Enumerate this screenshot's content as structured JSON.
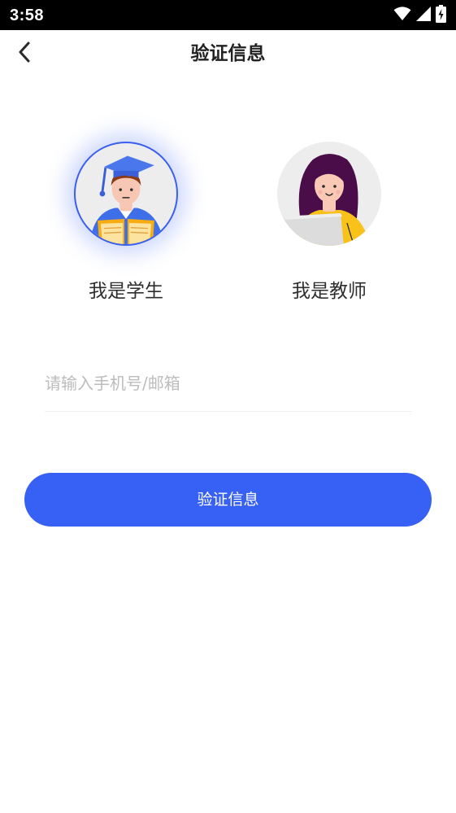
{
  "status_bar": {
    "time": "3:58",
    "icons": [
      "wifi-icon",
      "signal-icon",
      "battery-charging-icon"
    ]
  },
  "nav": {
    "title": "验证信息",
    "back_icon": "chevron-left-icon"
  },
  "roles": [
    {
      "label": "我是学生",
      "selected": true,
      "avatar": "student-avatar"
    },
    {
      "label": "我是教师",
      "selected": false,
      "avatar": "teacher-avatar"
    }
  ],
  "account_input": {
    "placeholder": "请输入手机号/邮箱",
    "value": ""
  },
  "submit": {
    "label": "验证信息"
  },
  "colors": {
    "accent": "#3760f4",
    "text_primary": "#222222",
    "placeholder": "#bcbcbc",
    "avatar_background": "#ededed"
  }
}
